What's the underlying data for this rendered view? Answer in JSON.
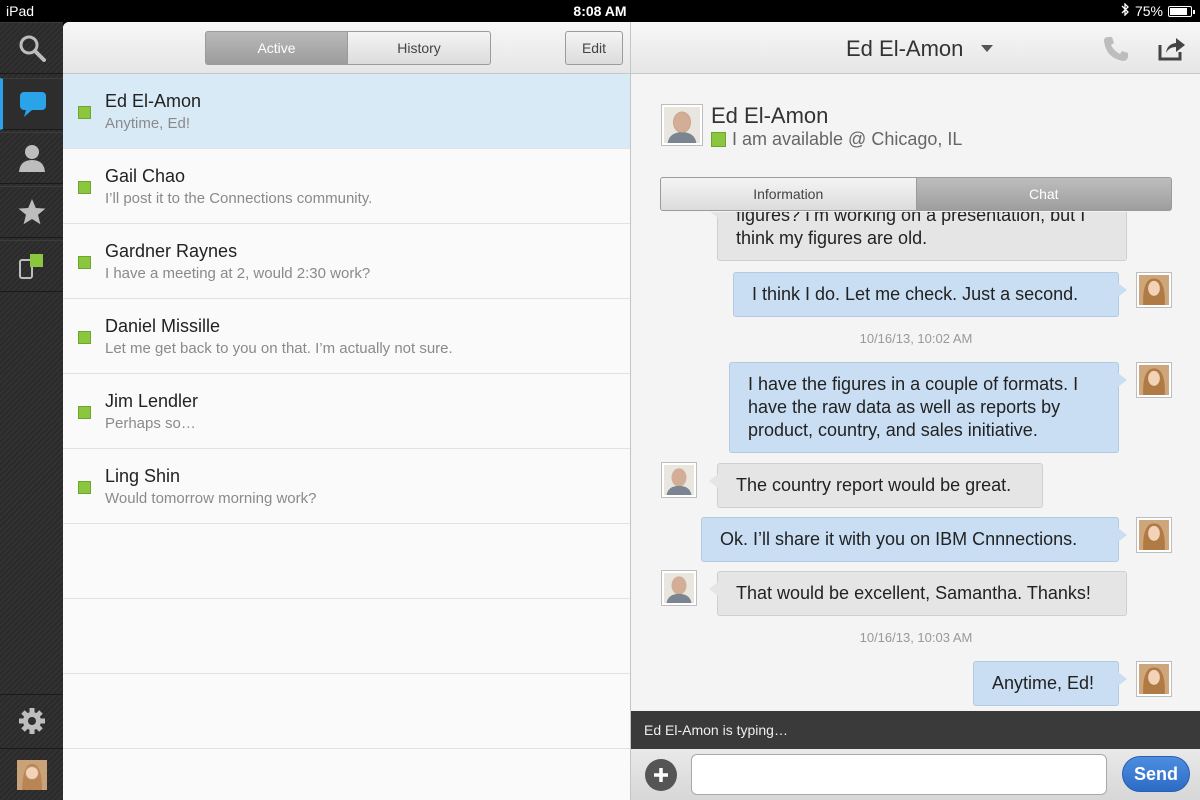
{
  "status_bar": {
    "device": "iPad",
    "time": "8:08 AM",
    "battery": "75%"
  },
  "rail": {
    "items": [
      "search-icon",
      "chat-icon",
      "contacts-icon",
      "favorites-icon",
      "meetings-icon"
    ],
    "active": "chat-icon",
    "bottom": [
      "settings-icon",
      "my-avatar"
    ]
  },
  "list": {
    "tabs": {
      "active": "Active",
      "history": "History"
    },
    "edit_label": "Edit",
    "conversations": [
      {
        "name": "Ed El-Amon",
        "last": "Anytime, Ed!",
        "status": "available",
        "selected": true
      },
      {
        "name": "Gail Chao",
        "last": "I’ll post it to the Connections community.",
        "status": "available"
      },
      {
        "name": "Gardner Raynes",
        "last": "I have a meeting at 2, would 2:30 work?",
        "status": "available"
      },
      {
        "name": "Daniel Missille",
        "last": "Let me get back to you on that. I’m actually not sure.",
        "status": "available"
      },
      {
        "name": "Jim Lendler",
        "last": "Perhaps so…",
        "status": "available"
      },
      {
        "name": "Ling Shin",
        "last": "Would tomorrow morning work?",
        "status": "available"
      }
    ]
  },
  "chat": {
    "title": "Ed El-Amon",
    "contact": {
      "name": "Ed El-Amon",
      "status": "I am available @ Chicago, IL"
    },
    "tabs": {
      "info": "Information",
      "chat": "Chat"
    },
    "messages": [
      {
        "dir": "in",
        "text": "figures? I’m working on a presentation, but I think my figures are old."
      },
      {
        "dir": "out",
        "text": "I think I do. Let me check. Just a second."
      },
      {
        "stamp": "10/16/13, 10:02 AM"
      },
      {
        "dir": "out",
        "text": "I have the figures in a couple of formats. I have the raw data as well as reports by product, country, and sales initiative."
      },
      {
        "dir": "in",
        "text": "The country report would be great."
      },
      {
        "dir": "out",
        "text": "Ok. I’ll share it with you on IBM Cnnnections."
      },
      {
        "dir": "in",
        "text": "That would be excellent, Samantha. Thanks!"
      },
      {
        "stamp": "10/16/13, 10:03 AM"
      },
      {
        "dir": "out",
        "text": "Anytime, Ed!"
      }
    ],
    "typing": "Ed El-Amon is typing…",
    "send_label": "Send",
    "accent": "#2c6cc6"
  }
}
